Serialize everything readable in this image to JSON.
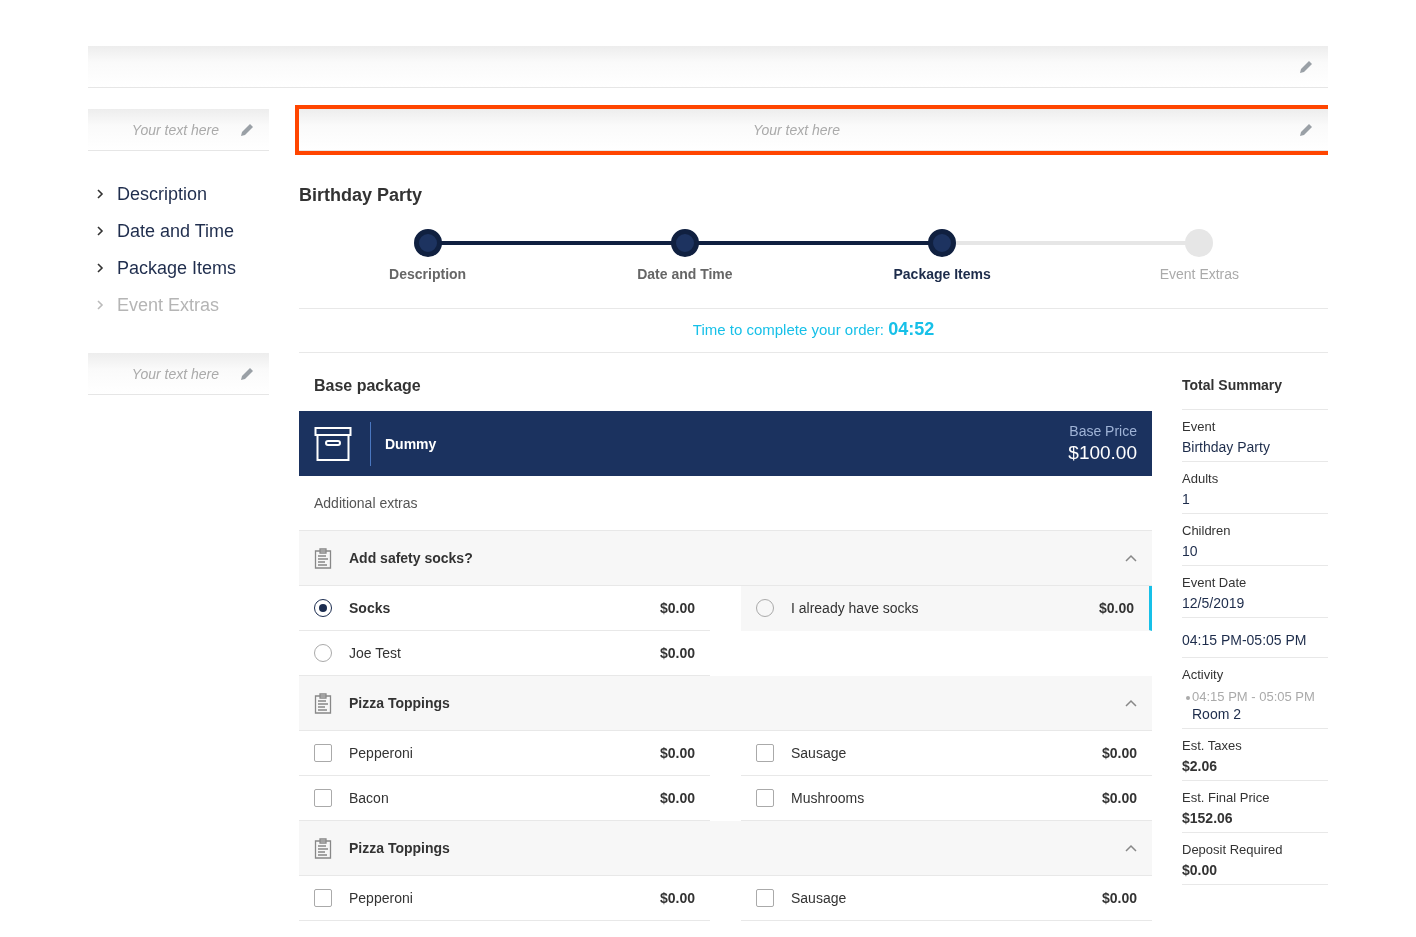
{
  "side_field_top": {
    "placeholder": "Your text here"
  },
  "header_field": {
    "placeholder": "Your text here",
    "selected": true
  },
  "sidebar": {
    "items": [
      {
        "label": "Description",
        "disabled": false
      },
      {
        "label": "Date and Time",
        "disabled": false
      },
      {
        "label": "Package Items",
        "disabled": false
      },
      {
        "label": "Event Extras",
        "disabled": true
      }
    ]
  },
  "side_field_bottom": {
    "placeholder": "Your text here"
  },
  "event_title": "Birthday Party",
  "steps": [
    {
      "label": "Description",
      "done": true,
      "selected": false
    },
    {
      "label": "Date and Time",
      "done": true,
      "selected": false
    },
    {
      "label": "Package Items",
      "done": true,
      "selected": true
    },
    {
      "label": "Event Extras",
      "done": false,
      "selected": false
    }
  ],
  "timer": {
    "label": "Time to complete your order:",
    "value": "04:52"
  },
  "base_package": {
    "heading": "Base package",
    "name": "Dummy",
    "price_label": "Base Price",
    "price": "$100.00"
  },
  "extras_heading": "Additional extras",
  "groups": [
    {
      "title": "Add safety socks?",
      "kind": "radio",
      "expanded": true,
      "options": [
        {
          "name": "Socks",
          "price": "$0.00",
          "selected": true,
          "highlighted": false
        },
        {
          "name": "I already have socks",
          "price": "$0.00",
          "selected": false,
          "highlighted": true
        },
        {
          "name": "Joe Test",
          "price": "$0.00",
          "selected": false,
          "highlighted": false
        }
      ]
    },
    {
      "title": "Pizza Toppings",
      "kind": "checkbox",
      "expanded": true,
      "options": [
        {
          "name": "Pepperoni",
          "price": "$0.00",
          "checked": false
        },
        {
          "name": "Sausage",
          "price": "$0.00",
          "checked": false
        },
        {
          "name": "Bacon",
          "price": "$0.00",
          "checked": false
        },
        {
          "name": "Mushrooms",
          "price": "$0.00",
          "checked": false
        }
      ]
    },
    {
      "title": "Pizza Toppings",
      "kind": "checkbox",
      "expanded": true,
      "options": [
        {
          "name": "Pepperoni",
          "price": "$0.00",
          "checked": false
        },
        {
          "name": "Sausage",
          "price": "$0.00",
          "checked": false
        }
      ]
    }
  ],
  "summary": {
    "title": "Total Summary",
    "entries": [
      {
        "kind": "plain",
        "label": "Event",
        "value": "Birthday Party"
      },
      {
        "kind": "plain",
        "label": "Adults",
        "value": "1"
      },
      {
        "kind": "plain",
        "label": "Children",
        "value": "10"
      },
      {
        "kind": "plain",
        "label": "Event Date",
        "value": "12/5/2019"
      },
      {
        "kind": "value_only",
        "value": "04:15 PM-05:05 PM"
      },
      {
        "kind": "activity",
        "label": "Activity",
        "time": "04:15 PM - 05:05 PM",
        "value": "Room 2"
      },
      {
        "kind": "bold",
        "label": "Est. Taxes",
        "value": "$2.06"
      },
      {
        "kind": "bold",
        "label": "Est. Final Price",
        "value": "$152.06"
      },
      {
        "kind": "bold",
        "label": "Deposit Required",
        "value": "$0.00"
      }
    ]
  }
}
